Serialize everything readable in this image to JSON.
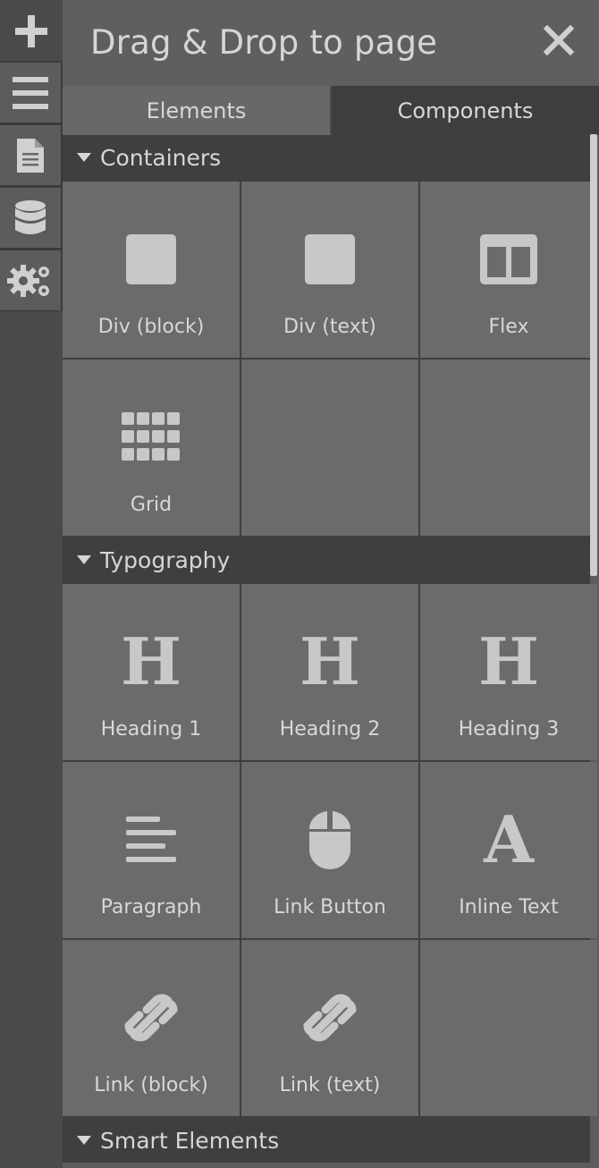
{
  "rail": {
    "items": [
      {
        "icon": "plus-icon"
      },
      {
        "icon": "layers-icon"
      },
      {
        "icon": "page-icon"
      },
      {
        "icon": "database-icon"
      },
      {
        "icon": "settings-gears-icon"
      }
    ]
  },
  "panel": {
    "title": "Drag & Drop to page",
    "tabs": [
      {
        "label": "Elements",
        "active": false
      },
      {
        "label": "Components",
        "active": true
      }
    ]
  },
  "sections": [
    {
      "title": "Containers",
      "items": [
        {
          "label": "Div (block)",
          "icon": "square-block-icon"
        },
        {
          "label": "Div (text)",
          "icon": "square-text-icon"
        },
        {
          "label": "Flex",
          "icon": "flex-layout-icon"
        },
        {
          "label": "Grid",
          "icon": "grid-icon"
        }
      ]
    },
    {
      "title": "Typography",
      "items": [
        {
          "label": "Heading 1",
          "glyph": "H"
        },
        {
          "label": "Heading 2",
          "glyph": "H"
        },
        {
          "label": "Heading 3",
          "glyph": "H"
        },
        {
          "label": "Paragraph",
          "icon": "paragraph-icon"
        },
        {
          "label": "Link Button",
          "icon": "mouse-icon"
        },
        {
          "label": "Inline Text",
          "glyph": "A"
        },
        {
          "label": "Link (block)",
          "icon": "link-icon"
        },
        {
          "label": "Link (text)",
          "icon": "link-icon"
        }
      ]
    },
    {
      "title": "Smart Elements"
    }
  ],
  "colors": {
    "background": "#5c5c5c",
    "header_dark": "#3f3f3f",
    "cell": "#6b6b6b",
    "text": "#d8d8d8",
    "icon": "#c8c8c8"
  }
}
